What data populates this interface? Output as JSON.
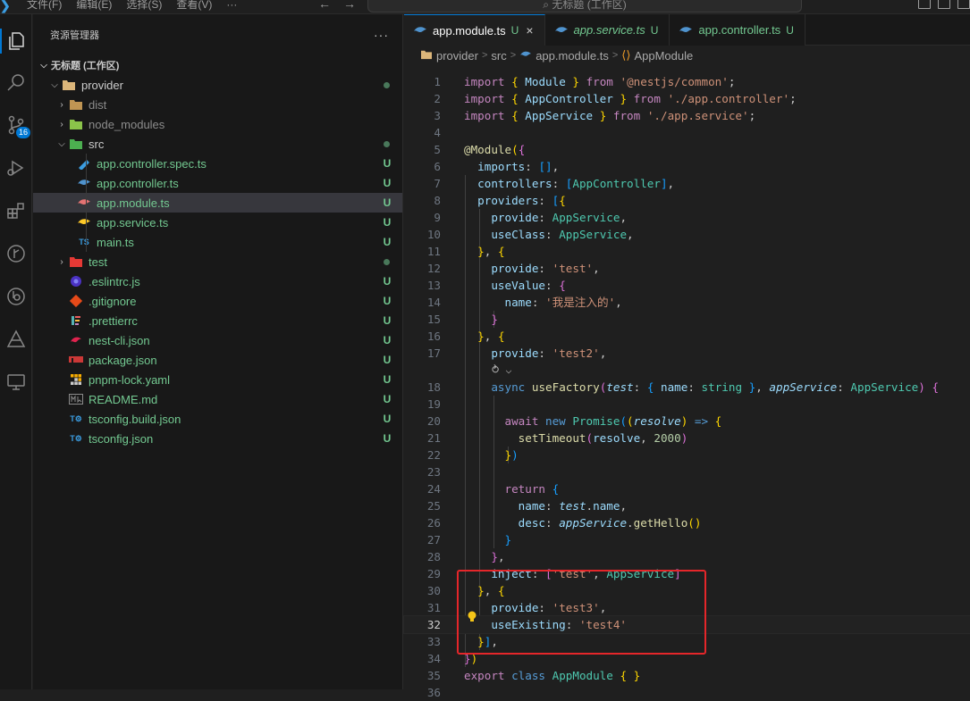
{
  "titlebar": {
    "menu": [
      "文件(F)",
      "编辑(E)",
      "选择(S)",
      "查看(V)",
      "···"
    ],
    "search": "无标题 (工作区)"
  },
  "activity": {
    "scm_badge": "16"
  },
  "explorer": {
    "title": "资源管理器",
    "more": "···",
    "workspace": "无标题 (工作区)",
    "rows": [
      {
        "label": "provider",
        "status": "dot"
      },
      {
        "label": "dist",
        "status": ""
      },
      {
        "label": "node_modules",
        "status": ""
      },
      {
        "label": "src",
        "status": "dot"
      },
      {
        "label": "app.controller.spec.ts",
        "status": "U"
      },
      {
        "label": "app.controller.ts",
        "status": "U"
      },
      {
        "label": "app.module.ts",
        "status": "U"
      },
      {
        "label": "app.service.ts",
        "status": "U"
      },
      {
        "label": "main.ts",
        "status": "U"
      },
      {
        "label": "test",
        "status": "dot"
      },
      {
        "label": ".eslintrc.js",
        "status": "U"
      },
      {
        "label": ".gitignore",
        "status": "U"
      },
      {
        "label": ".prettierrc",
        "status": "U"
      },
      {
        "label": "nest-cli.json",
        "status": "U"
      },
      {
        "label": "package.json",
        "status": "U"
      },
      {
        "label": "pnpm-lock.yaml",
        "status": "U"
      },
      {
        "label": "README.md",
        "status": "U"
      },
      {
        "label": "tsconfig.build.json",
        "status": "U"
      },
      {
        "label": "tsconfig.json",
        "status": "U"
      }
    ]
  },
  "tabs": [
    {
      "label": "app.module.ts",
      "status": "U",
      "close": "×"
    },
    {
      "label": "app.service.ts",
      "status": "U"
    },
    {
      "label": "app.controller.ts",
      "status": "U"
    }
  ],
  "breadcrumb": {
    "items": [
      "provider",
      "src",
      "app.module.ts",
      "AppModule"
    ],
    "sep": ">"
  },
  "code": {
    "numbers": [
      "1",
      "2",
      "3",
      "4",
      "5",
      "6",
      "7",
      "8",
      "9",
      "10",
      "11",
      "12",
      "13",
      "14",
      "15",
      "16",
      "17",
      "18",
      "19",
      "20",
      "21",
      "22",
      "23",
      "24",
      "25",
      "26",
      "27",
      "28",
      "29",
      "30",
      "31",
      "32",
      "33",
      "34",
      "35",
      "36"
    ],
    "type_hint": "⥁ ⌵",
    "lines": {
      "l1": [
        "import",
        "{",
        "Module",
        "}",
        "from",
        "'@nestjs/common'",
        ";"
      ],
      "l2": [
        "import",
        "{",
        "AppController",
        "}",
        "from",
        "'./app.controller'",
        ";"
      ],
      "l3": [
        "import",
        "{",
        "AppService",
        "}",
        "from",
        "'./app.service'",
        ";"
      ],
      "l5": [
        "@",
        "Module",
        "(",
        "{"
      ],
      "l6": [
        "imports",
        ":",
        "[]",
        ","
      ],
      "l7": [
        "controllers",
        ":",
        "[",
        "AppController",
        "]",
        ","
      ],
      "l8": [
        "providers",
        ":",
        "[",
        "{"
      ],
      "l9": [
        "provide",
        ":",
        "AppService",
        ","
      ],
      "l10": [
        "useClass",
        ":",
        "AppService",
        ","
      ],
      "l11": [
        "}",
        ", ",
        "{"
      ],
      "l12": [
        "provide",
        ":",
        "'test'",
        ","
      ],
      "l13": [
        "useValue",
        ":",
        "{"
      ],
      "l14": [
        "name",
        ":",
        "'我是注入的'",
        ","
      ],
      "l15": [
        "}"
      ],
      "l16": [
        "}",
        ", ",
        "{"
      ],
      "l17": [
        "provide",
        ":",
        "'test2'",
        ","
      ],
      "l18": [
        "async",
        "useFactory",
        "(",
        "test",
        ":",
        "{",
        "name",
        ":",
        "string",
        "}",
        ",",
        "appService",
        ":",
        "AppService",
        ")",
        "{"
      ],
      "l20": [
        "await",
        "new",
        "Promise",
        "(",
        "(",
        "resolve",
        ")",
        "=>",
        "{"
      ],
      "l21": [
        "setTimeout",
        "(",
        "resolve",
        ",",
        "2000",
        ")"
      ],
      "l22": [
        "}",
        ")"
      ],
      "l24": [
        "return",
        "{"
      ],
      "l25": [
        "name",
        ":",
        "test",
        ".",
        "name",
        ","
      ],
      "l26": [
        "desc",
        ":",
        "appService",
        ".",
        "getHello",
        "()"
      ],
      "l27": [
        "}"
      ],
      "l28": [
        "}",
        ","
      ],
      "l29": [
        "inject",
        ":",
        "[",
        "'test'",
        ",",
        "AppService",
        "]"
      ],
      "l30": [
        "}",
        ", ",
        "{"
      ],
      "l31": [
        "provide",
        ":",
        "'test3'",
        ","
      ],
      "l32": [
        "useExisting",
        ":",
        "'test4'"
      ],
      "l33": [
        "}",
        "]",
        ","
      ],
      "l34": [
        "}",
        ")"
      ],
      "l35": [
        "export",
        "class",
        "AppModule",
        "{",
        "}"
      ]
    }
  },
  "colors": {
    "accent": "#0078d4",
    "untracked": "#73c991",
    "highlight_box": "#e5262a"
  }
}
